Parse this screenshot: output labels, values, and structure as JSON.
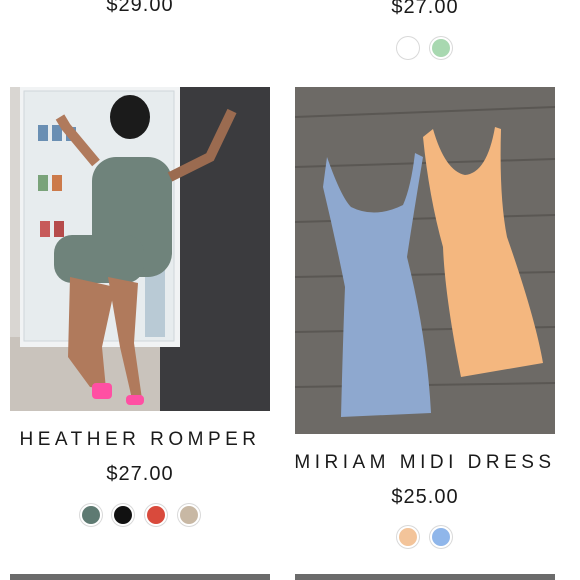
{
  "products": [
    {
      "name": "",
      "price": "$29.00",
      "swatches": []
    },
    {
      "name": "",
      "price": "$27.00",
      "swatches": [
        "#ffffff",
        "#a8d8b0"
      ]
    },
    {
      "name": "HEATHER ROMPER",
      "price": "$27.00",
      "swatches": [
        "#5e7a72",
        "#111111",
        "#d94a3c",
        "#c8b8a4"
      ]
    },
    {
      "name": "MIRIAM MIDI DRESS",
      "price": "$25.00",
      "swatches": [
        "#f3c49a",
        "#8fb6ea"
      ]
    }
  ]
}
